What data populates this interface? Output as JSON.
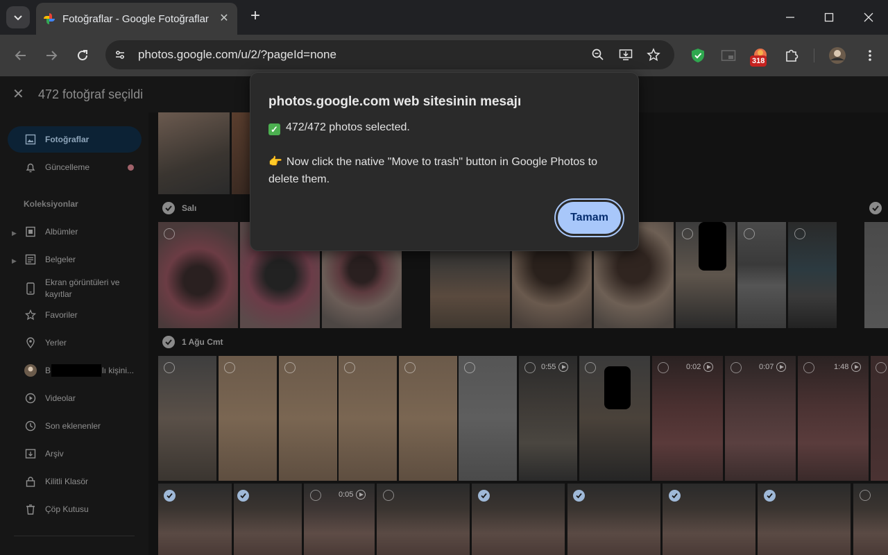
{
  "browser": {
    "tab_title": "Fotoğraflar - Google Fotoğraflar",
    "url": "photos.google.com/u/2/?pageId=none",
    "extension_badge": "318"
  },
  "page": {
    "selection_count": "472 fotoğraf seçildi",
    "sidebar": {
      "items": [
        {
          "label": "Fotoğraflar",
          "icon": "photo-icon"
        },
        {
          "label": "Güncelleme",
          "icon": "bell-icon"
        },
        {
          "label": "Albümler",
          "icon": "album-icon"
        },
        {
          "label": "Belgeler",
          "icon": "document-icon"
        },
        {
          "label": "Ekran görüntüleri ve kayıtlar",
          "icon": "phone-screenshot-icon"
        },
        {
          "label": "Favoriler",
          "icon": "star-icon"
        },
        {
          "label": "Yerler",
          "icon": "location-pin-icon"
        },
        {
          "label_prefix": "B",
          "label_suffix": "lı kişini...",
          "icon": "avatar"
        },
        {
          "label": "Videolar",
          "icon": "play-circle-icon"
        },
        {
          "label": "Son eklenenler",
          "icon": "clock-icon"
        },
        {
          "label": "Arşiv",
          "icon": "archive-icon"
        },
        {
          "label": "Kilitli Klasör",
          "icon": "lock-icon"
        },
        {
          "label": "Çöp Kutusu",
          "icon": "trash-icon"
        }
      ],
      "section_title": "Koleksiyonlar"
    },
    "days": {
      "tuesday": "Salı",
      "first_sunday": "1 Ağu Cmt"
    },
    "durations": [
      "0:55",
      "0:02",
      "0:07",
      "1:48",
      "0:05"
    ]
  },
  "dialog": {
    "title": "photos.google.com web sitesinin mesajı",
    "line1": "472/472 photos selected.",
    "line2": "Now click the native \"Move to trash\" button in Google Photos to delete them.",
    "ok_label": "Tamam"
  }
}
